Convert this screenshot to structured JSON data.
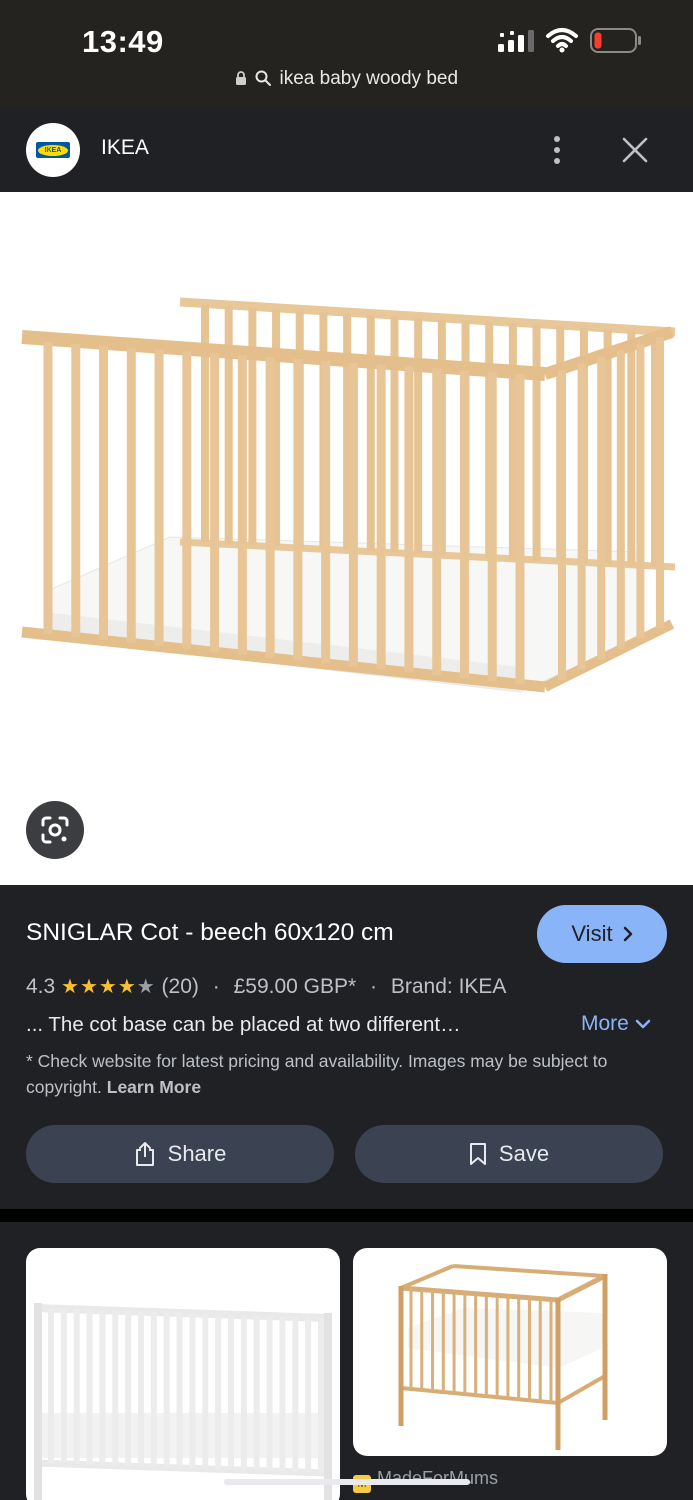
{
  "status_bar": {
    "time": "13:49",
    "url": "ikea baby woody bed",
    "icons": [
      "signal-icon",
      "wifi-icon",
      "battery-low-icon",
      "lock-icon",
      "search-icon"
    ]
  },
  "source": {
    "name": "IKEA",
    "logo": "ikea-logo",
    "logo_text": "IKEA"
  },
  "product": {
    "title": "SNIGLAR Cot - beech 60x120 cm",
    "visit_label": "Visit",
    "rating": "4.3",
    "rating_value": 4.3,
    "rating_max": 5,
    "review_count": "(20)",
    "price": "£59.00 GBP*",
    "brand": "Brand: IKEA",
    "snippet": "... The cot base can be placed at two different…",
    "more_label": "More",
    "disclaimer": "* Check website for latest pricing and availability. Images may be subject to copyright.",
    "learn_more": "Learn More",
    "share_label": "Share",
    "save_label": "Save"
  },
  "related": [
    {
      "image": "white-cot"
    },
    {
      "image": "beech-cot",
      "source": "MadeForMums",
      "favicon_text": "M"
    }
  ],
  "colors": {
    "accent": "#8ab4f8",
    "background": "#202124",
    "pill": "#3b4252",
    "star": "#fbc02d",
    "wood": "#e2bd8c"
  }
}
